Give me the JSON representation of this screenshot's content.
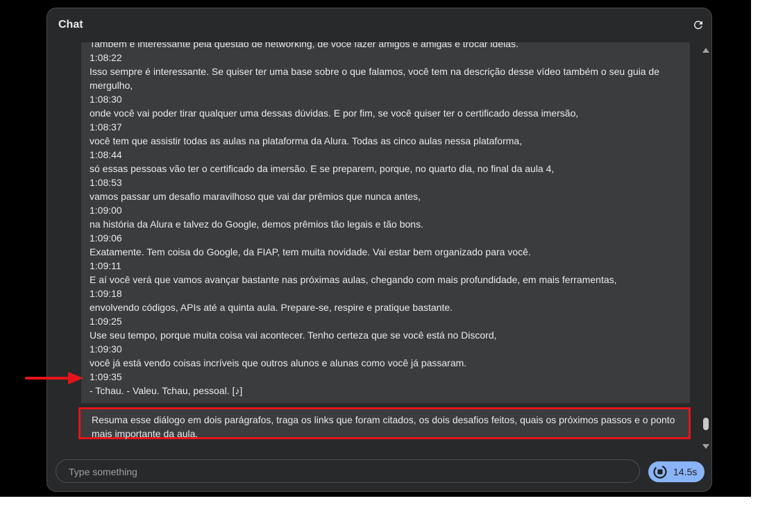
{
  "chat": {
    "title": "Chat",
    "transcript": [
      "Também é interessante pela questão de networking, de você fazer amigos e amigas e trocar ideias.",
      "1:08:22",
      "Isso sempre é interessante. Se quiser ter uma base sobre o que falamos, você tem na descrição desse vídeo também o seu guia de mergulho,",
      "1:08:30",
      "onde você vai poder tirar qualquer uma dessas dúvidas. E por fim, se você quiser ter o certificado dessa imersão,",
      "1:08:37",
      "você tem que assistir todas as aulas na plataforma da Alura. Todas as cinco aulas nessa plataforma,",
      "1:08:44",
      "só essas pessoas vão ter o certificado da imersão. E se preparem, porque, no quarto dia, no final da aula 4,",
      "1:08:53",
      "vamos passar um desafio maravilhoso que vai dar prêmios que nunca antes,",
      "1:09:00",
      "na história da Alura e talvez do Google, demos prêmios tão legais e tão bons.",
      "1:09:06",
      "Exatamente. Tem coisa do Google, da FIAP, tem muita novidade. Vai estar bem organizado para você.",
      "1:09:11",
      "E aí você verá que vamos avançar bastante nas próximas aulas, chegando com mais profundidade, em mais ferramentas,",
      "1:09:18",
      "envolvendo códigos, APIs até a quinta aula. Prepare-se, respire e pratique bastante.",
      "1:09:25",
      "Use seu tempo, porque muita coisa vai acontecer. Tenho certeza que se você está no Discord,",
      "1:09:30",
      "você já está vendo coisas incríveis que outros alunos e alunas como você já passaram.",
      "1:09:35",
      "- Tchau. - Valeu. Tchau, pessoal. [♪]"
    ],
    "prompt": "Resuma esse diálogo em dois parágrafos, traga os links que foram citados, os dois desafios feitos, quais os próximos passos e o ponto mais importante da aula.",
    "input_placeholder": "Type something",
    "stop_label": "14.5s",
    "colors": {
      "accent": "#8ab4f8",
      "highlight": "#e5141a",
      "panel": "#28292a",
      "transcript_bg": "#3b3c3d"
    },
    "icons": {
      "refresh": "refresh-icon",
      "stop": "stop-icon",
      "arrow": "red-arrow-annotation"
    }
  }
}
